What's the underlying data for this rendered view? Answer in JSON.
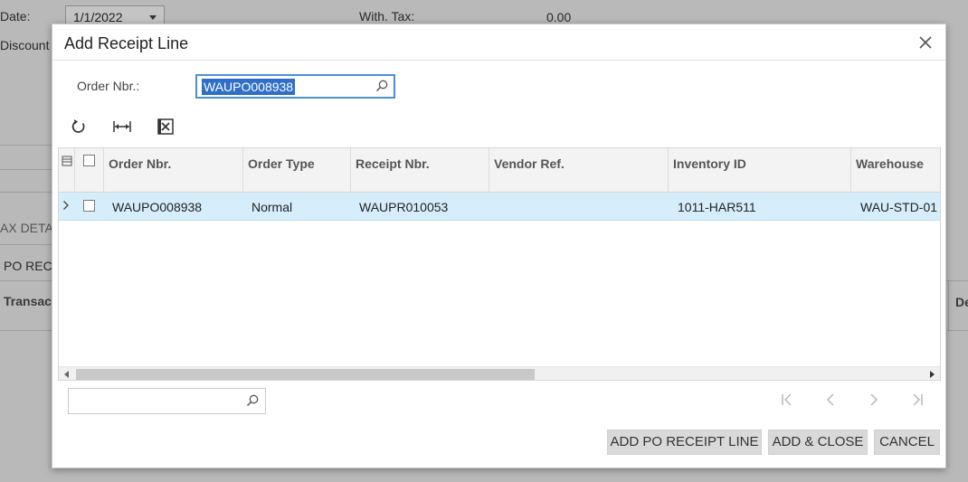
{
  "background": {
    "date_label": "Date:",
    "date_value": "1/1/2022",
    "with_tax_label": "With. Tax:",
    "with_tax_value": "0.00",
    "discount_label": "Discount",
    "tax_details_tab": "AX DETA",
    "po_receipt_tab": "PO REC",
    "transaction_col": "Transact",
    "de_col": "De"
  },
  "dialog": {
    "title": "Add Receipt Line",
    "order_nbr_label": "Order Nbr.:",
    "order_nbr_value": "WAUPO008938",
    "toolbar": {
      "refresh_icon": "refresh-icon",
      "fit_icon": "fit-columns-icon",
      "excel_icon": "export-excel-icon"
    },
    "grid": {
      "columns": [
        "Order Nbr.",
        "Order Type",
        "Receipt Nbr.",
        "Vendor Ref.",
        "Inventory ID",
        "Warehouse"
      ],
      "rows": [
        {
          "order_nbr": "WAUPO008938",
          "order_type": "Normal",
          "receipt_nbr": "WAUPR010053",
          "vendor_ref": "",
          "inventory_id": "1011-HAR511",
          "warehouse": "WAU-STD-01"
        }
      ],
      "selected_row_color": "#d6eefc"
    },
    "buttons": {
      "add_po_receipt_line": "ADD PO RECEIPT LINE",
      "add_and_close": "ADD & CLOSE",
      "cancel": "CANCEL"
    },
    "accent_color": "#2f6fc8"
  }
}
